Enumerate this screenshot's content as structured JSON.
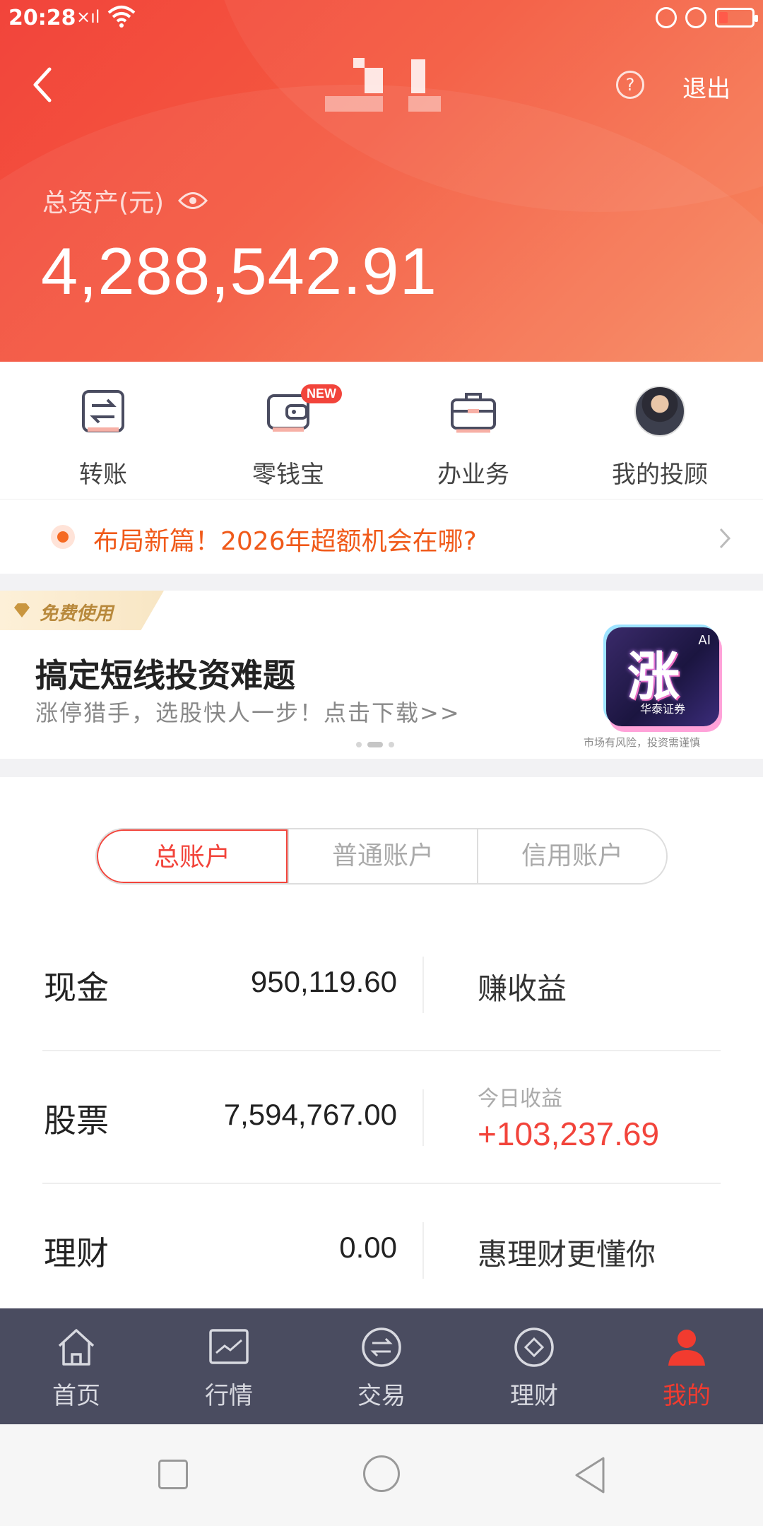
{
  "status_bar": {
    "time": "20:28",
    "signal": "×ıl"
  },
  "header": {
    "logout_label": "退出",
    "help_label": "?",
    "total_assets_label": "总资产(元)",
    "total_assets_value": "4,288,542.91"
  },
  "quick_actions": [
    {
      "label": "转账",
      "icon": "transfer-icon"
    },
    {
      "label": "零钱宝",
      "icon": "wallet-icon",
      "badge": "NEW"
    },
    {
      "label": "办业务",
      "icon": "briefcase-icon"
    },
    {
      "label": "我的投顾",
      "icon": "advisor-avatar"
    }
  ],
  "news": {
    "text": "布局新篇！2026年超额机会在哪?"
  },
  "banner": {
    "tag": "免费使用",
    "title": "搞定短线投资难题",
    "subtitle": "涨停猎手，选股快人一步！点击下载>>",
    "logo_char": "涨",
    "logo_ai": "AI",
    "logo_brand": "华泰证券",
    "risk_notice": "市场有风险，投资需谨慎"
  },
  "account": {
    "tabs": [
      "总账户",
      "普通账户",
      "信用账户"
    ],
    "active_tab": 0,
    "rows": [
      {
        "name": "现金",
        "value": "950,119.60",
        "side": "赚收益"
      },
      {
        "name": "股票",
        "value": "7,594,767.00",
        "side_label": "今日收益",
        "side_value": "+103,237.69"
      },
      {
        "name": "理财",
        "value": "0.00",
        "side": "惠理财更懂你"
      }
    ]
  },
  "bottom_nav": [
    {
      "label": "首页",
      "icon": "home-icon"
    },
    {
      "label": "行情",
      "icon": "chart-icon"
    },
    {
      "label": "交易",
      "icon": "exchange-icon"
    },
    {
      "label": "理财",
      "icon": "diamond-icon"
    },
    {
      "label": "我的",
      "icon": "person-icon",
      "active": true
    }
  ],
  "colors": {
    "accent": "#f2443b",
    "nav_bg": "#4a4c60",
    "news_orange": "#f05a1a"
  }
}
